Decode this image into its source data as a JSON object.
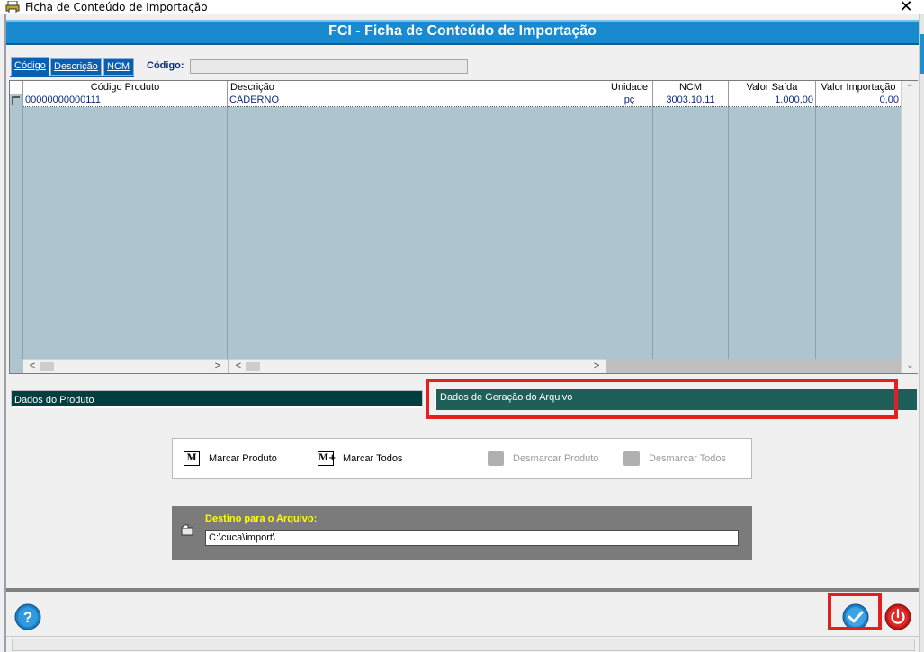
{
  "window": {
    "title": "Ficha de Conteúdo de Importação",
    "close_glyph": "✕",
    "icon": "app-printer-icon"
  },
  "header": {
    "title": "FCI - Ficha de Conteúdo de Importação"
  },
  "search": {
    "tabs": [
      {
        "label": "Código",
        "active": true
      },
      {
        "label": "Descrição",
        "active": false
      },
      {
        "label": "NCM",
        "active": false
      }
    ],
    "label": "Código:",
    "value": ""
  },
  "grid": {
    "columns": [
      "Código Produto",
      "Descrição",
      "Unidade",
      "NCM",
      "Valor Saída",
      "Valor Importação"
    ],
    "rows": [
      {
        "codigo": "00000000000111",
        "descricao": "CADERNO",
        "unidade": "pç",
        "ncm": "3003.10.11",
        "valor_saida": "1.000,00",
        "valor_importacao": "0,00"
      }
    ],
    "scroll_up": "⌃",
    "scroll_down": "⌄",
    "scroll_left": "<",
    "scroll_right": ">"
  },
  "panel_tabs": {
    "produto": "Dados do Produto",
    "geracao": "Dados de Geração do Arquivo"
  },
  "actions": [
    {
      "label": "Marcar Produto",
      "icon_text": "M",
      "enabled": true
    },
    {
      "label": "Marcar Todos",
      "icon_text": "M+",
      "enabled": true
    },
    {
      "label": "Desmarcar Produto",
      "icon_text": "",
      "enabled": false
    },
    {
      "label": "Desmarcar Todos",
      "icon_text": "",
      "enabled": false
    }
  ],
  "destino": {
    "label": "Destino para o Arquivo:",
    "value": "C:\\cuca\\import\\"
  },
  "colors": {
    "header_blue": "#1a8ad0",
    "grid_bg": "#aec5cf",
    "panel_tab_dark": "#003f3f",
    "panel_tab_active": "#1e5f5a",
    "highlight_red": "#e3201f",
    "destino_label": "#ffff00"
  }
}
